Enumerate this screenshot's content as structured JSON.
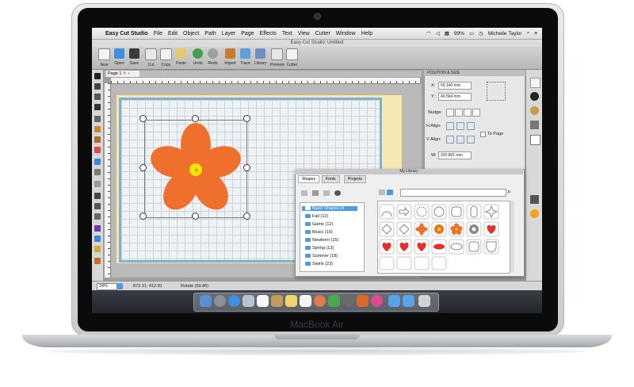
{
  "device": {
    "label": "MacBook Air"
  },
  "menubar": {
    "apple": "",
    "app_name": "Easy Cut Studio",
    "menus": [
      "File",
      "Edit",
      "Object",
      "Path",
      "Layer",
      "Page",
      "Effects",
      "Text",
      "View",
      "Cutter",
      "Window",
      "Help"
    ],
    "battery": "99%",
    "user": "Michelle Taylor"
  },
  "window": {
    "title": "Easy Cut Studio: Untitled"
  },
  "toolbar": {
    "buttons": [
      {
        "label": "New",
        "icon": "new-document-icon",
        "color": "#f4f4f4"
      },
      {
        "label": "Open",
        "icon": "folder-open-icon",
        "color": "#3f8fe0"
      },
      {
        "label": "Save",
        "icon": "floppy-disk-icon",
        "color": "#3c3c3c"
      },
      {
        "label": "Cut",
        "icon": "scissors-icon",
        "color": "#e8e8e8"
      },
      {
        "label": "Copy",
        "icon": "copy-icon",
        "color": "#f1f1f1"
      },
      {
        "label": "Paste",
        "icon": "paste-icon",
        "color": "#e8c86c"
      },
      {
        "label": "Undo",
        "icon": "undo-icon",
        "color": "#3fa14a"
      },
      {
        "label": "Redo",
        "icon": "redo-icon",
        "color": "#9aa49b"
      },
      {
        "label": "Import",
        "icon": "import-icon",
        "color": "#c87a30"
      },
      {
        "label": "Trace",
        "icon": "trace-icon",
        "color": "#5ea0d6"
      },
      {
        "label": "Library",
        "icon": "library-icon",
        "color": "#6f8fc3"
      },
      {
        "label": "Preview",
        "icon": "preview-icon",
        "color": "#e6e6e6"
      },
      {
        "label": "Cutter",
        "icon": "cutter-icon",
        "color": "#f2f2f2"
      }
    ]
  },
  "document": {
    "tab_label": "Page 1"
  },
  "position_size": {
    "title": "POSITION & SIZE",
    "x_label": "X:",
    "x_value": "50.140 mm",
    "y_label": "Y:",
    "y_value": "40.564 mm",
    "nudge_label": "Nudge:",
    "h_align_label": "H Align:",
    "v_align_label": "V Align:",
    "to_page_label": "To Page",
    "w_label": "W:",
    "w_value": "202.801 mm"
  },
  "library": {
    "title": "My Library",
    "tabs": [
      "Shapes",
      "Fonts",
      "Projects"
    ],
    "tree": [
      "Basic Shapes (4",
      "Fall (12)",
      "Game (12)",
      "Music (10)",
      "Newborn (15)",
      "Spring (13)",
      "Summer (18)",
      "Swirls (23)"
    ],
    "selected_tree_index": 0
  },
  "statusbar": {
    "zoom": "34%",
    "coords": "872.31, 412.91",
    "rotate": "Rotate (59.86)"
  },
  "colors": {
    "accent": "#4f9be0",
    "flower": "#ef6f2d",
    "flower_center": "#f5e600",
    "heart": "#e62f2b",
    "grid_border": "#7fb0d8"
  }
}
